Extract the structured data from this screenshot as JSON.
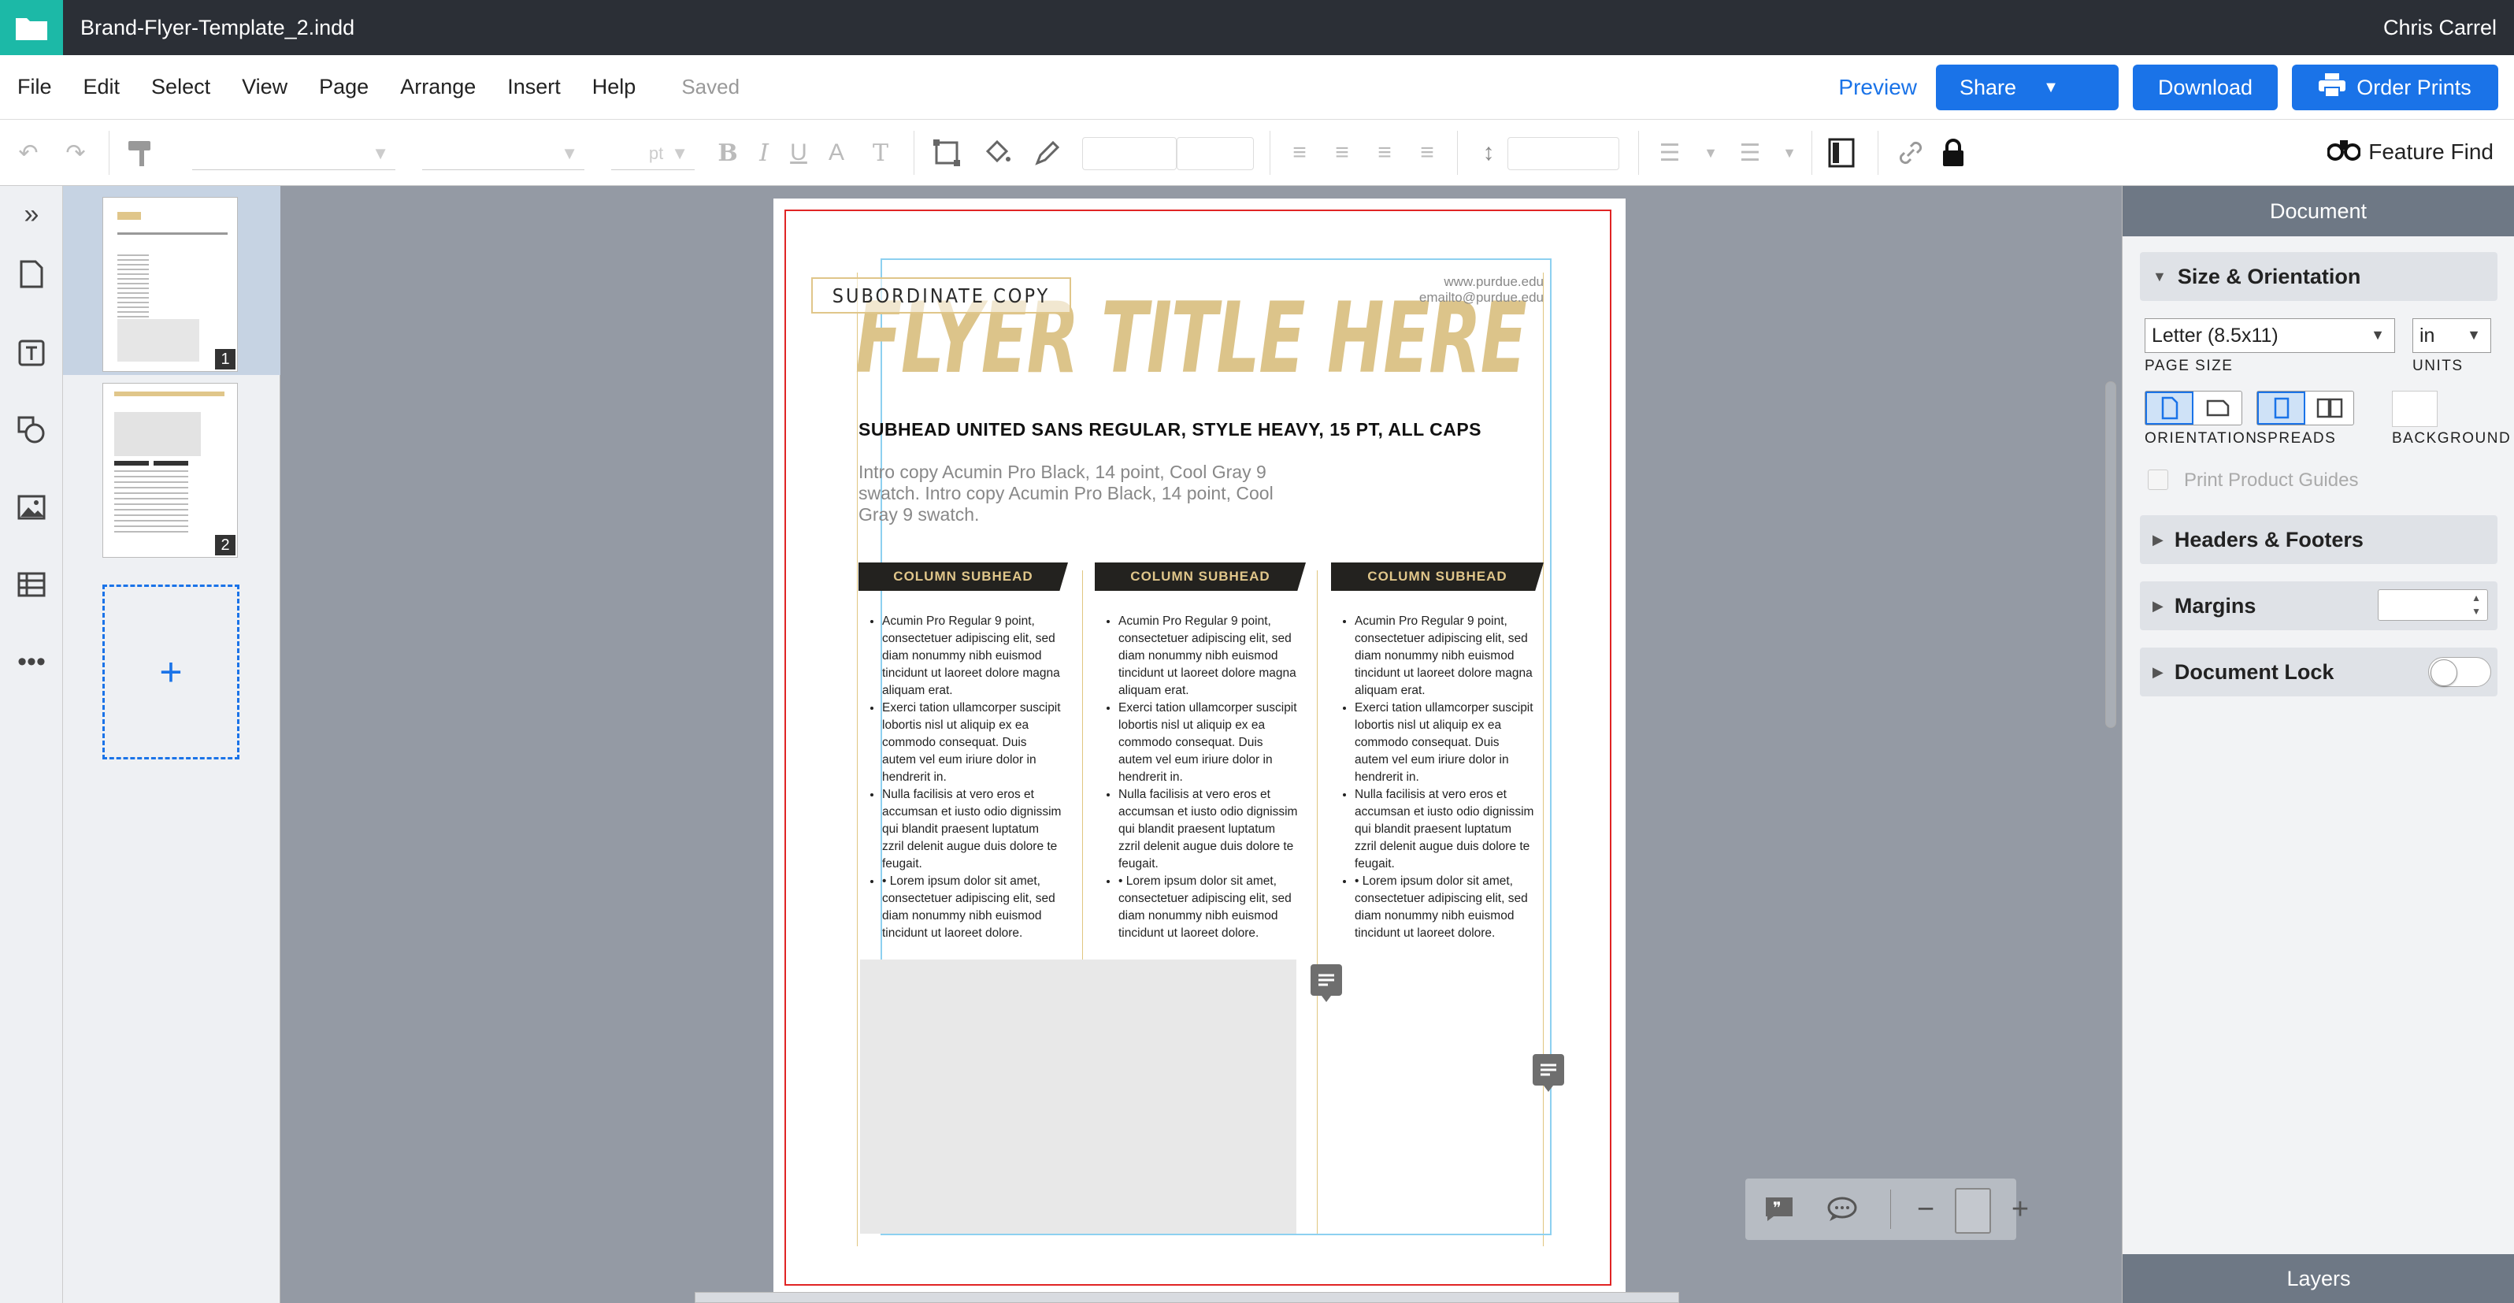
{
  "window": {
    "doc_name": "Brand-Flyer-Template_2.indd",
    "user_name": "Chris Carrel"
  },
  "menu": {
    "items": [
      "File",
      "Edit",
      "Select",
      "View",
      "Page",
      "Arrange",
      "Insert",
      "Help"
    ],
    "status": "Saved"
  },
  "actions": {
    "preview": "Preview",
    "share": "Share",
    "download": "Download",
    "order_prints": "Order Prints"
  },
  "toolbar": {
    "unit": "pt",
    "feature_find": "Feature Find"
  },
  "pages_panel": {
    "pages": [
      "1",
      "2"
    ],
    "add_label": "+"
  },
  "flyer": {
    "subordinate_copy": "SUBORDINATE COPY",
    "title": "FLYER TITLE HERE",
    "contact_web": "www.purdue.edu",
    "contact_email": "emailto@purdue.edu",
    "subhead": "SUBHEAD UNITED SANS REGULAR, STYLE HEAVY, 15 PT, ALL CAPS",
    "intro": "Intro copy Acumin Pro Black, 14 point, Cool Gray 9 swatch. Intro copy Acumin Pro Black, 14 point, Cool Gray 9 swatch.",
    "columns": [
      {
        "head": "COLUMN SUBHEAD",
        "bullets": [
          "Acumin Pro Regular 9 point, consectetuer adipiscing elit, sed diam nonummy nibh euismod tincidunt ut laoreet dolore magna aliquam erat.",
          "Exerci tation ullamcorper suscipit lobortis nisl ut aliquip ex ea commodo consequat. Duis autem vel eum iriure dolor in hendrerit in.",
          "Nulla facilisis at vero eros et accumsan et iusto odio dignissim qui blandit praesent luptatum zzril delenit augue duis dolore te feugait.",
          "• Lorem ipsum dolor sit amet, consectetuer adipiscing elit, sed diam nonummy nibh euismod tincidunt ut laoreet dolore."
        ]
      },
      {
        "head": "COLUMN SUBHEAD",
        "bullets": [
          "Acumin Pro Regular 9 point, consectetuer adipiscing elit, sed diam nonummy nibh euismod tincidunt ut laoreet dolore magna aliquam erat.",
          "Exerci tation ullamcorper suscipit lobortis nisl ut aliquip ex ea commodo consequat. Duis autem vel eum iriure dolor in hendrerit in.",
          "Nulla facilisis at vero eros et accumsan et iusto odio dignissim qui blandit praesent luptatum zzril delenit augue duis dolore te feugait.",
          "• Lorem ipsum dolor sit amet, consectetuer adipiscing elit, sed diam nonummy nibh euismod tincidunt ut laoreet dolore."
        ]
      },
      {
        "head": "COLUMN SUBHEAD",
        "bullets": [
          "Acumin Pro Regular 9 point, consectetuer adipiscing elit, sed diam nonummy nibh euismod tincidunt ut laoreet dolore magna aliquam erat.",
          "Exerci tation ullamcorper suscipit lobortis nisl ut aliquip ex ea commodo consequat. Duis autem vel eum iriure dolor in hendrerit in.",
          "Nulla facilisis at vero eros et accumsan et iusto odio dignissim qui blandit praesent luptatum zzril delenit augue duis dolore te feugait.",
          "• Lorem ipsum dolor sit amet, consectetuer adipiscing elit, sed diam nonummy nibh euismod tincidunt ut laoreet dolore."
        ]
      }
    ]
  },
  "right_panel": {
    "title": "Document",
    "size_section": "Size & Orientation",
    "page_size_value": "Letter (8.5x11)",
    "page_size_label": "PAGE SIZE",
    "units_value": "in",
    "units_label": "UNITS",
    "orientation_label": "ORIENTATION",
    "spreads_label": "SPREADS",
    "background_label": "BACKGROUND",
    "print_guides": "Print Product Guides",
    "headers_footers": "Headers & Footers",
    "margins": "Margins",
    "document_lock": "Document Lock",
    "layers": "Layers"
  },
  "colors": {
    "brand_gold": "#dcc48a",
    "accent_blue": "#1a73e8",
    "bleed_red": "#e02424",
    "app_teal": "#1cb9a7"
  }
}
